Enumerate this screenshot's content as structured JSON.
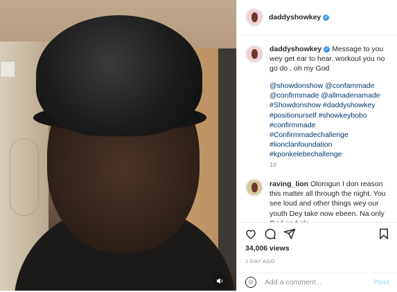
{
  "media": {
    "type": "video",
    "volume_icon": "volume-icon"
  },
  "header": {
    "username": "daddyshowkey",
    "verified_icon": "verified-badge-icon"
  },
  "caption": {
    "username": "daddyshowkey",
    "text": "Message to you wey get ear to hear. workout you no go do , oh my God",
    "mentions_hashtags": "@showdonshow @confammade @confirmmade @allmadenamade #Showdonshow #daddyshowkey #positionurself #showkeybobo #confirmmade #Confirmmadechallenge #lionclanfoundation #kponkelebechallenge",
    "time": "1d"
  },
  "comment": {
    "username": "raving_lion",
    "text": "Olorogun I don reason this matter all through the night. You see loud and other things wey our youth Dey take now ebeen. Na only God go help"
  },
  "actions": {
    "like_icon": "heart-icon",
    "comment_icon": "comment-icon",
    "share_icon": "share-icon",
    "save_icon": "bookmark-icon"
  },
  "stats": {
    "views": "34,006 views",
    "posted": "1 DAY AGO"
  },
  "add_comment": {
    "placeholder": "Add a comment...",
    "post_label": "Post",
    "emoji_icon": "emoji-icon"
  }
}
